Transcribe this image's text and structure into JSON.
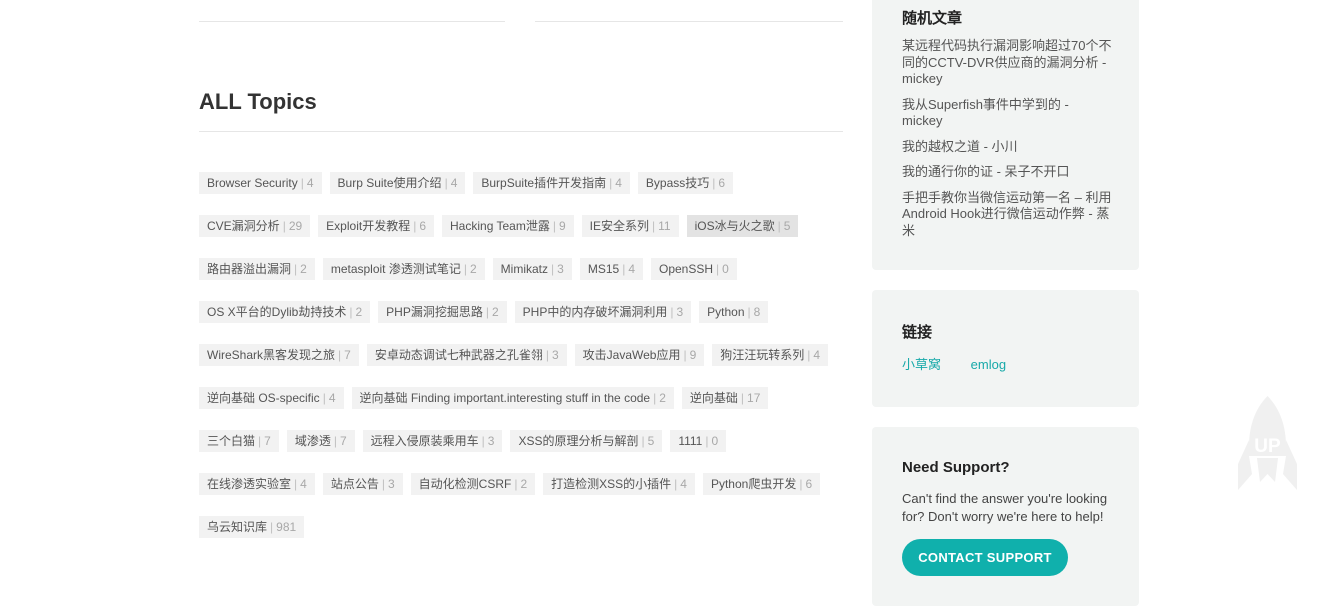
{
  "main": {
    "title": "ALL Topics",
    "tag_separator": "|",
    "tags": [
      {
        "name": "Browser Security",
        "count": "4"
      },
      {
        "name": "Burp Suite使用介绍",
        "count": "4"
      },
      {
        "name": "BurpSuite插件开发指南",
        "count": "4"
      },
      {
        "name": "Bypass技巧",
        "count": "6"
      },
      {
        "name": "CVE漏洞分析",
        "count": "29"
      },
      {
        "name": "Exploit开发教程",
        "count": "6"
      },
      {
        "name": "Hacking Team泄露",
        "count": "9"
      },
      {
        "name": "IE安全系列",
        "count": "11"
      },
      {
        "name": "iOS冰与火之歌",
        "count": "5",
        "active": true
      },
      {
        "name": "路由器溢出漏洞",
        "count": "2"
      },
      {
        "name": "metasploit 渗透测试笔记",
        "count": "2"
      },
      {
        "name": "Mimikatz",
        "count": "3"
      },
      {
        "name": "MS15",
        "count": "4"
      },
      {
        "name": "OpenSSH",
        "count": "0"
      },
      {
        "name": "OS X平台的Dylib劫持技术",
        "count": "2"
      },
      {
        "name": "PHP漏洞挖掘思路",
        "count": "2"
      },
      {
        "name": "PHP中的内存破坏漏洞利用",
        "count": "3"
      },
      {
        "name": "Python",
        "count": "8"
      },
      {
        "name": "WireShark黑客发现之旅",
        "count": "7"
      },
      {
        "name": "安卓动态调试七种武器之孔雀翎",
        "count": "3"
      },
      {
        "name": "攻击JavaWeb应用",
        "count": "9"
      },
      {
        "name": "狗汪汪玩转系列",
        "count": "4"
      },
      {
        "name": "逆向基础 OS-specific",
        "count": "4"
      },
      {
        "name": "逆向基础 Finding important.interesting stuff in the code",
        "count": "2"
      },
      {
        "name": "逆向基础",
        "count": "17"
      },
      {
        "name": "三个白猫",
        "count": "7"
      },
      {
        "name": "域渗透",
        "count": "7"
      },
      {
        "name": "远程入侵原装乘用车",
        "count": "3"
      },
      {
        "name": "XSS的原理分析与解剖",
        "count": "5"
      },
      {
        "name": "1111",
        "count": "0"
      },
      {
        "name": "在线渗透实验室",
        "count": "4"
      },
      {
        "name": "站点公告",
        "count": "3"
      },
      {
        "name": "自动化检测CSRF",
        "count": "2"
      },
      {
        "name": "打造检测XSS的小插件",
        "count": "4"
      },
      {
        "name": "Python爬虫开发",
        "count": "6"
      },
      {
        "name": "乌云知识库",
        "count": "981"
      }
    ]
  },
  "sidebar": {
    "random": {
      "title": "随机文章",
      "posts": [
        "某远程代码执行漏洞影响超过70个不同的CCTV-DVR供应商的漏洞分析 - mickey",
        "我从Superfish事件中学到的 - mickey",
        "我的越权之道 - 小川",
        "我的通行你的证 - 呆子不开口",
        "手把手教你当微信运动第一名 – 利用Android Hook进行微信运动作弊 - 蒸米"
      ]
    },
    "links": {
      "title": "链接",
      "items": [
        "小草窝",
        "emlog"
      ]
    },
    "support": {
      "title": "Need Support?",
      "text": "Can't find the answer you're looking for? Don't worry we're here to help!",
      "button": "CONTACT SUPPORT"
    }
  },
  "scroll_top": {
    "label": "UP",
    "icon": "rocket-icon"
  },
  "colors": {
    "accent": "#10b0ac",
    "link": "#17a9a9",
    "tag_bg": "#f2f2f2",
    "widget_bg": "#f2f4f3"
  }
}
